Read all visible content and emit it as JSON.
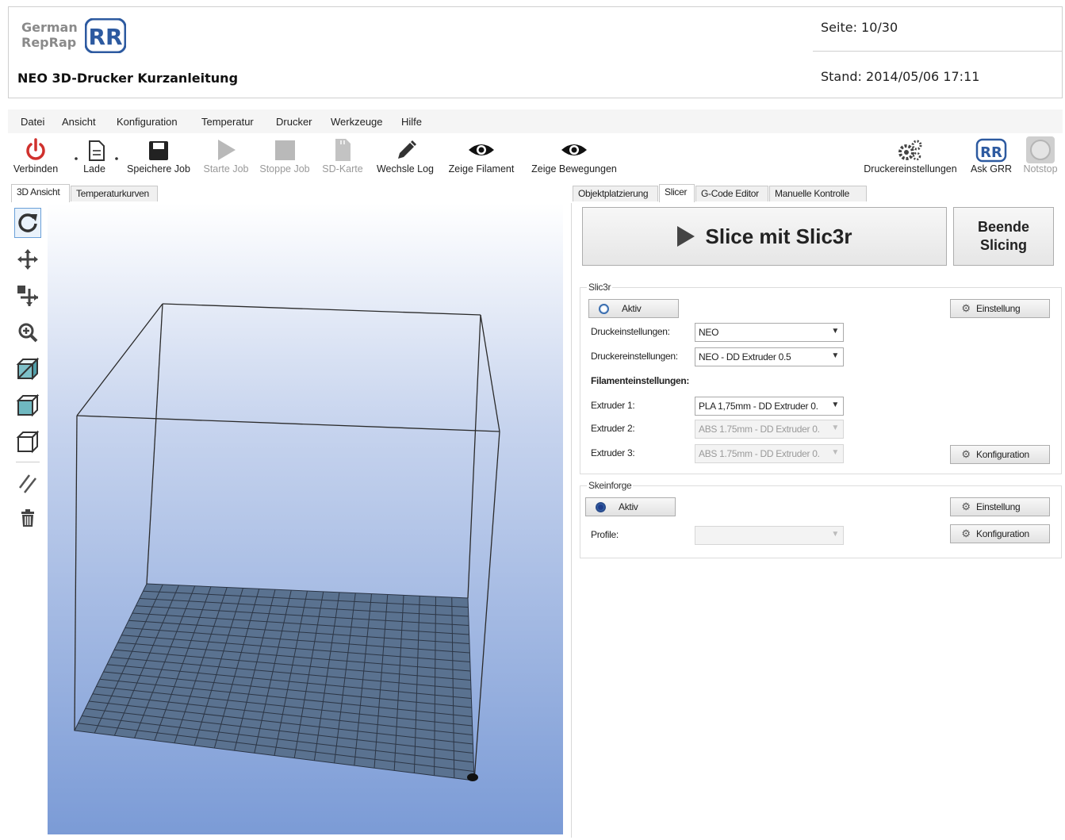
{
  "doc": {
    "logo_line1": "German",
    "logo_line2": "RepRap",
    "title": "NEO 3D-Drucker Kurzanleitung",
    "page": "Seite: 10/30",
    "date": "Stand: 2014/05/06 17:11"
  },
  "menu": [
    "Datei",
    "Ansicht",
    "Konfiguration",
    "Temperatur",
    "Drucker",
    "Werkzeuge",
    "Hilfe"
  ],
  "toolbar": {
    "connect": "Verbinden",
    "load": "Lade",
    "save_job": "Speichere Job",
    "start_job": "Starte Job",
    "stop_job": "Stoppe Job",
    "sd_card": "SD-Karte",
    "toggle_log": "Wechsle Log",
    "show_filament": "Zeige Filament",
    "show_moves": "Zeige Bewegungen",
    "printer_settings": "Druckereinstellungen",
    "ask_grr": "Ask GRR",
    "emergency_stop": "Notstop"
  },
  "left_tabs": [
    "3D Ansicht",
    "Temperaturkurven"
  ],
  "right_tabs": [
    "Objektplatzierung",
    "Slicer",
    "G-Code Editor",
    "Manuelle Kontrolle"
  ],
  "slicer": {
    "slice_button": "Slice mit Slic3r",
    "stop_slicing_line1": "Beende",
    "stop_slicing_line2": "Slicing",
    "slic3r_group": "Slic3r",
    "active": "Aktiv",
    "settings_button": "Einstellung",
    "print_settings_label": "Druckeinstellungen:",
    "print_settings_value": "NEO",
    "printer_settings_label": "Druckereinstellungen:",
    "printer_settings_value": "NEO - DD Extruder 0.5",
    "filament_header": "Filamenteinstellungen:",
    "extruder1_label": "Extruder 1:",
    "extruder1_value": "PLA 1,75mm - DD Extruder 0.",
    "extruder2_label": "Extruder 2:",
    "extruder2_value": "ABS 1.75mm - DD Extruder 0.",
    "extruder3_label": "Extruder 3:",
    "extruder3_value": "ABS 1.75mm - DD Extruder 0.",
    "config_button": "Konfiguration",
    "skeinforge_group": "Skeinforge",
    "sf_active": "Aktiv",
    "sf_settings_button": "Einstellung",
    "profile_label": "Profile:",
    "profile_value": "",
    "sf_config_button": "Konfiguration"
  },
  "colors": {
    "accent": "#3c6fb0",
    "connect_red": "#d0312d",
    "bed": "#5a7290"
  }
}
